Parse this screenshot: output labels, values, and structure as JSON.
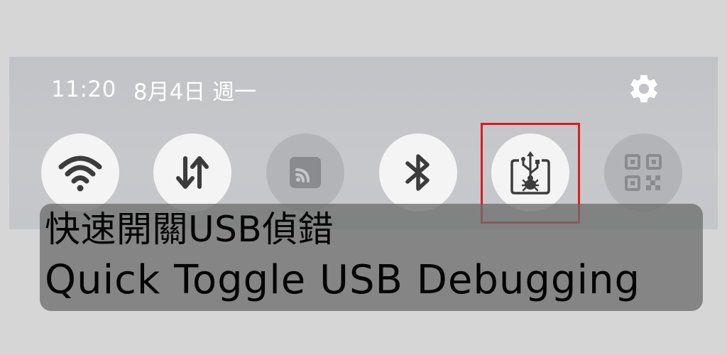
{
  "status_bar": {
    "time": "11:20",
    "date": "8月4日 週一"
  },
  "quick_tiles": [
    {
      "icon": "wifi-icon",
      "state": "on"
    },
    {
      "icon": "mobile-data-icon",
      "state": "on"
    },
    {
      "icon": "cast-icon",
      "state": "off"
    },
    {
      "icon": "bluetooth-icon",
      "state": "on"
    },
    {
      "icon": "usb-debugging-icon",
      "state": "on",
      "highlighted": true
    },
    {
      "icon": "qr-code-icon",
      "state": "off"
    }
  ],
  "caption": {
    "title_zh": "快速開關USB偵錯",
    "title_en": "Quick Toggle USB Debugging"
  },
  "colors": {
    "highlight": "#e0191e",
    "tile_on": "#f4f4f4",
    "tile_off": "#b3b4b7",
    "icon_dark": "#3c3c3c"
  }
}
